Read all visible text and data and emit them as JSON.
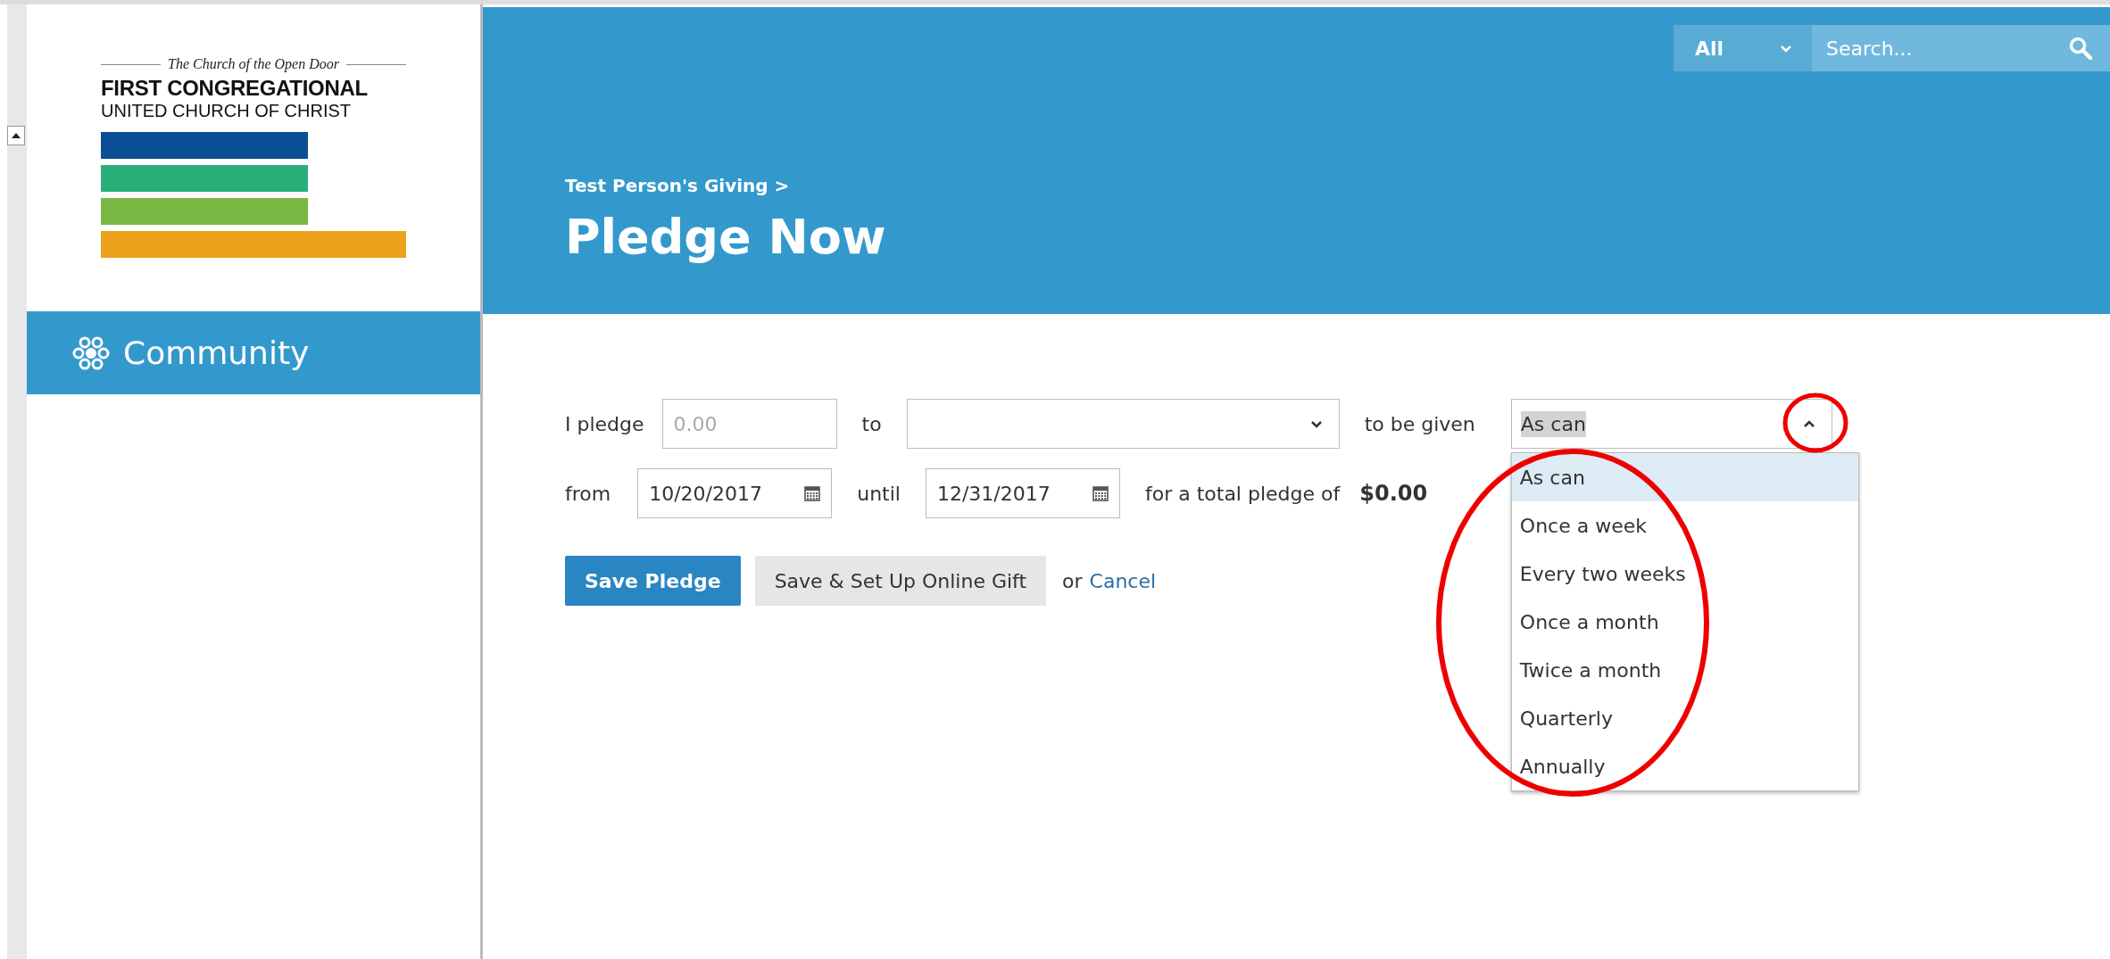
{
  "logo": {
    "tagline": "The Church of the Open Door",
    "name_line_1": "FIRST CONGREGATIONAL",
    "name_line_2": "UNITED CHURCH OF CHRIST"
  },
  "sidebar": {
    "items": [
      {
        "label": "Community",
        "selected": true
      }
    ]
  },
  "header": {
    "search": {
      "scope": "All",
      "placeholder": "Search..."
    },
    "breadcrumb": "Test Person's Giving >",
    "title": "Pledge Now"
  },
  "form": {
    "pledge_label": "I pledge",
    "amount": {
      "placeholder": "0.00"
    },
    "to_label": "to",
    "given_label": "to be given",
    "frequency": {
      "value": "As can",
      "expanded": true,
      "options": [
        {
          "label": "As can",
          "selected": true
        },
        {
          "label": "Once a week",
          "selected": false
        },
        {
          "label": "Every two weeks",
          "selected": false
        },
        {
          "label": "Once a month",
          "selected": false
        },
        {
          "label": "Twice a month",
          "selected": false
        },
        {
          "label": "Quarterly",
          "selected": false
        },
        {
          "label": "Annually",
          "selected": false
        }
      ]
    },
    "from_label": "from",
    "start_date": "10/20/2017",
    "until_label": "until",
    "end_date": "12/31/2017",
    "total_label": "for a total pledge of",
    "total": "$0.00",
    "save_button": "Save Pledge",
    "online_gift_button": "Save & Set Up Online Gift",
    "or_text": "or",
    "cancel_link": "Cancel"
  },
  "annotations": {
    "toggle_circled": true,
    "options_circled": true
  }
}
